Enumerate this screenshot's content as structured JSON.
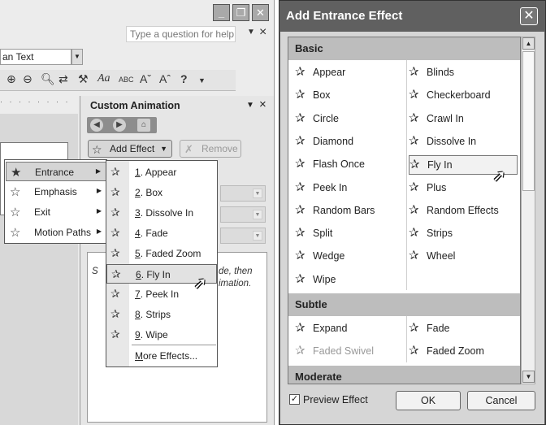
{
  "left_window": {
    "controls": {
      "minimize": "_",
      "restore": "❐",
      "close": "✕"
    },
    "help_placeholder": "Type a question for help",
    "font_box": "an Text",
    "ruler": "· · · · · · · ·",
    "toolbar_icons": [
      "zoom-in-icon",
      "zoom-out-icon",
      "find-icon",
      "replace-icon",
      "format-painter-icon",
      "text-style-icon",
      "abc-icon",
      "font-grow-icon",
      "font-shrink-icon",
      "help-icon"
    ]
  },
  "custom_animation": {
    "title": "Custom Animation",
    "add_effect": "Add Effect",
    "remove": "Remove",
    "hint_left": "S",
    "hint_line1": "de, then",
    "hint_line2": "imation."
  },
  "effect_type_menu": {
    "items": [
      {
        "label": "Entrance",
        "active": true
      },
      {
        "label": "Emphasis",
        "active": false
      },
      {
        "label": "Exit",
        "active": false
      },
      {
        "label": "Motion Paths",
        "active": false
      }
    ]
  },
  "entrance_submenu": {
    "items": [
      {
        "num": "1",
        "label": "Appear"
      },
      {
        "num": "2",
        "label": "Box"
      },
      {
        "num": "3",
        "label": "Dissolve In"
      },
      {
        "num": "4",
        "label": "Fade"
      },
      {
        "num": "5",
        "label": "Faded Zoom"
      },
      {
        "num": "6",
        "label": "Fly In"
      },
      {
        "num": "7",
        "label": "Peek In"
      },
      {
        "num": "8",
        "label": "Strips"
      },
      {
        "num": "9",
        "label": "Wipe"
      }
    ],
    "more": "More Effects..."
  },
  "dialog": {
    "title": "Add Entrance Effect",
    "sections": [
      {
        "name": "Basic",
        "left": [
          "Appear",
          "Box",
          "Circle",
          "Diamond",
          "Flash Once",
          "Peek In",
          "Random Bars",
          "Split",
          "Wedge",
          "Wipe"
        ],
        "right": [
          "Blinds",
          "Checkerboard",
          "Crawl In",
          "Dissolve In",
          "Fly In",
          "Plus",
          "Random Effects",
          "Strips",
          "Wheel"
        ]
      },
      {
        "name": "Subtle",
        "left": [
          "Expand",
          "Faded Swivel"
        ],
        "right": [
          "Fade",
          "Faded Zoom"
        ]
      },
      {
        "name": "Moderate",
        "left": [],
        "right": []
      }
    ],
    "selected": "Fly In",
    "disabled": [
      "Faded Swivel"
    ],
    "preview_label": "Preview Effect",
    "preview_checked": true,
    "ok": "OK",
    "cancel": "Cancel"
  }
}
